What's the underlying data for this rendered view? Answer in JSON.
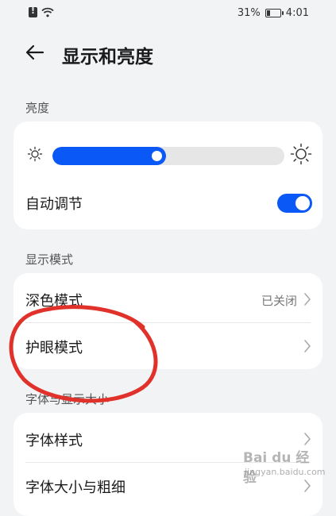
{
  "status_bar": {
    "battery": "31%",
    "time": "4:01",
    "battery_level": 0.31
  },
  "header": {
    "title": "显示和亮度"
  },
  "brightness_section": {
    "label": "亮度",
    "slider_value": 0.49,
    "auto_adjust_label": "自动调节",
    "auto_adjust_on": true
  },
  "display_mode_section": {
    "label": "显示模式",
    "dark_mode_label": "深色模式",
    "dark_mode_value": "已关闭",
    "eye_comfort_label": "护眼模式"
  },
  "font_section": {
    "label": "字体与显示大小",
    "font_style_label": "字体样式",
    "font_size_label": "字体大小与粗细"
  },
  "watermark": {
    "line1": "Bai du 经验",
    "line2": "jingyan.baidu.com"
  },
  "colors": {
    "accent": "#0a59f7",
    "annotation": "#e0322a",
    "background": "#f1f3f5"
  }
}
